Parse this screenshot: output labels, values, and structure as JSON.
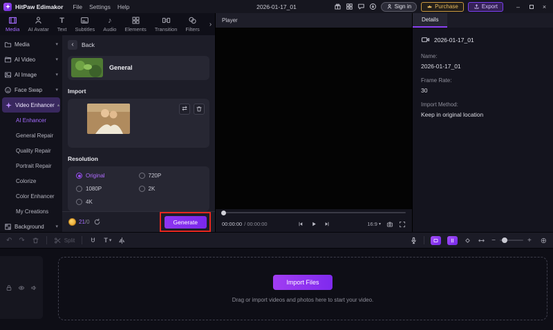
{
  "titlebar": {
    "app_name": "HitPaw Edimakor",
    "menus": [
      "File",
      "Settings",
      "Help"
    ],
    "project_name": "2026-01-17_01",
    "signin_label": "Sign in",
    "purchase_label": "Purchase",
    "export_label": "Export"
  },
  "tabbar": {
    "tabs": [
      {
        "label": "Media"
      },
      {
        "label": "AI Avatar"
      },
      {
        "label": "Text"
      },
      {
        "label": "Subtitles"
      },
      {
        "label": "Audio"
      },
      {
        "label": "Elements"
      },
      {
        "label": "Transition"
      },
      {
        "label": "Filters"
      }
    ]
  },
  "sidebar": {
    "groups": [
      {
        "label": "Media"
      },
      {
        "label": "AI Video"
      },
      {
        "label": "AI Image"
      },
      {
        "label": "Face Swap"
      },
      {
        "label": "Video Enhancer"
      }
    ],
    "enhancer_children": [
      {
        "label": "AI Enhancer"
      },
      {
        "label": "General Repair"
      },
      {
        "label": "Quality Repair"
      },
      {
        "label": "Portrait Repair"
      },
      {
        "label": "Colorize"
      },
      {
        "label": "Color Enhancer"
      },
      {
        "label": "My Creations"
      }
    ],
    "tail_group": {
      "label": "Background"
    }
  },
  "enhancer": {
    "back_label": "Back",
    "model_label": "General",
    "import_label": "Import",
    "resolution_label": "Resolution",
    "resolutions": [
      "Original",
      "720P",
      "1080P",
      "2K",
      "4K"
    ],
    "selected_resolution": "Original",
    "credits_left": "21",
    "credits_right": "/0",
    "generate_label": "Generate"
  },
  "player": {
    "title": "Player",
    "current_time": "00:00:00",
    "total_time": "/ 00:00:00",
    "aspect_ratio": "16:9"
  },
  "details": {
    "tab_label": "Details",
    "clip_title": "2026-01-17_01",
    "name_label": "Name:",
    "name_value": "2026-01-17_01",
    "framerate_label": "Frame Rate:",
    "framerate_value": "30",
    "import_method_label": "Import Method:",
    "import_method_value": "Keep in original location"
  },
  "toolbar": {
    "split_label": "Split",
    "text_tool_label": "T"
  },
  "timeline": {
    "import_button_label": "Import Files",
    "drop_hint": "Drag or import videos and photos here to start your video."
  },
  "icons": {
    "chevron_down": "▾",
    "chevron_up": "▴",
    "chevron_right": "›",
    "back": "‹",
    "swap": "⇄",
    "minimize": "–",
    "close": "×",
    "undo": "↶",
    "redo": "↷",
    "note": "♪",
    "minus": "−",
    "plus": "+",
    "target": "⊕",
    "text_glyph": "T"
  },
  "colors": {
    "accent_purple": "#8a3ff2",
    "purchase_yellow": "#e6b85c",
    "annotation_red": "#e8281e"
  }
}
